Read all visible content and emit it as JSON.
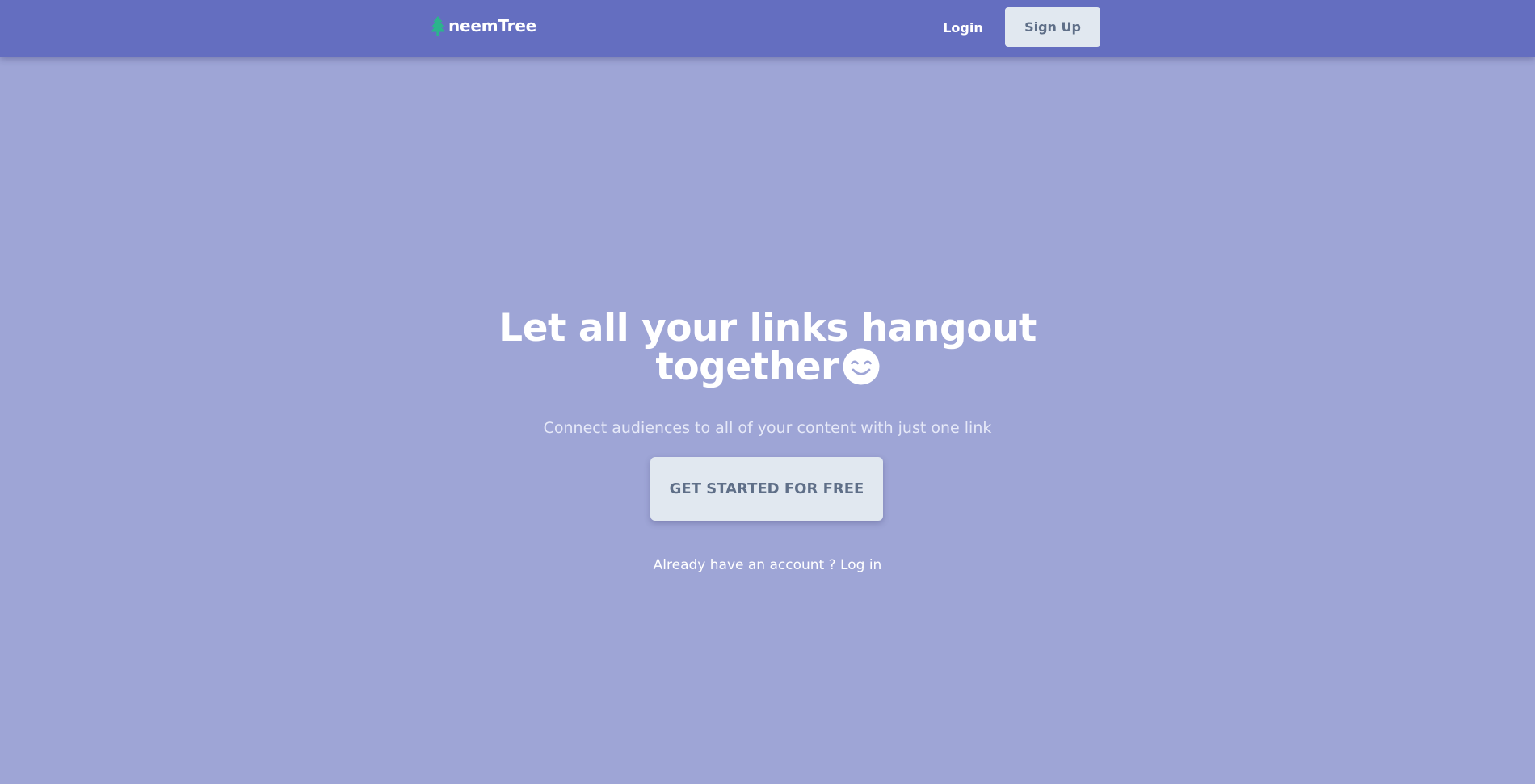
{
  "colors": {
    "navbar_bg": "#646ec0",
    "page_bg": "#9ea5d6",
    "button_bg": "#e1e8f0",
    "button_text": "#5f6f88",
    "logo_accent": "#2bb48c",
    "subtitle_text": "#e6e9f8"
  },
  "navbar": {
    "brand_icon": "tree-icon",
    "brand_name": "neemTree",
    "login_label": "Login",
    "signup_label": "Sign Up"
  },
  "hero": {
    "headline_line1": "Let all your links hangout",
    "headline_line2": "together",
    "headline_emoji_icon": "smiling-face-icon",
    "subtitle": "Connect audiences to all of your content with just one link",
    "cta_label": "GET STARTED FOR FREE",
    "account_prompt": "Already have an account ?",
    "login_link": "Log in"
  }
}
